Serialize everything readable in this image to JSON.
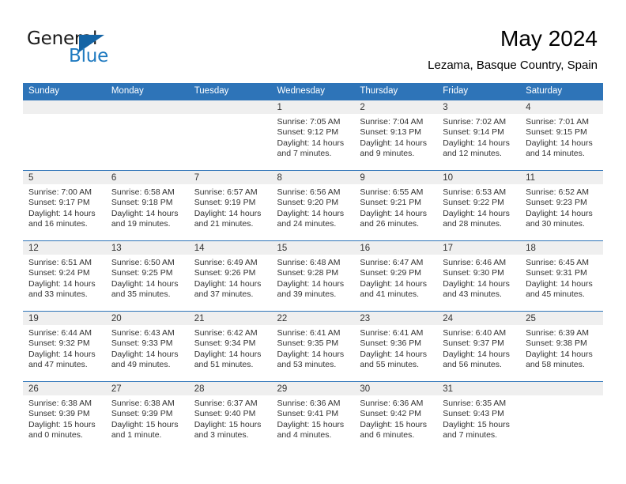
{
  "brand": {
    "name_part1": "General",
    "name_part2": "Blue",
    "logo_icon": "triangle-icon",
    "accent_color": "#1f7ac0",
    "header_color": "#2e74b8"
  },
  "header": {
    "title": "May 2024",
    "subtitle": "Lezama, Basque Country, Spain"
  },
  "calendar": {
    "weekday_headers": [
      "Sunday",
      "Monday",
      "Tuesday",
      "Wednesday",
      "Thursday",
      "Friday",
      "Saturday"
    ],
    "weeks": [
      [
        {
          "day": "",
          "sunrise": "",
          "sunset": "",
          "daylight1": "",
          "daylight2": ""
        },
        {
          "day": "",
          "sunrise": "",
          "sunset": "",
          "daylight1": "",
          "daylight2": ""
        },
        {
          "day": "",
          "sunrise": "",
          "sunset": "",
          "daylight1": "",
          "daylight2": ""
        },
        {
          "day": "1",
          "sunrise": "Sunrise: 7:05 AM",
          "sunset": "Sunset: 9:12 PM",
          "daylight1": "Daylight: 14 hours",
          "daylight2": "and 7 minutes."
        },
        {
          "day": "2",
          "sunrise": "Sunrise: 7:04 AM",
          "sunset": "Sunset: 9:13 PM",
          "daylight1": "Daylight: 14 hours",
          "daylight2": "and 9 minutes."
        },
        {
          "day": "3",
          "sunrise": "Sunrise: 7:02 AM",
          "sunset": "Sunset: 9:14 PM",
          "daylight1": "Daylight: 14 hours",
          "daylight2": "and 12 minutes."
        },
        {
          "day": "4",
          "sunrise": "Sunrise: 7:01 AM",
          "sunset": "Sunset: 9:15 PM",
          "daylight1": "Daylight: 14 hours",
          "daylight2": "and 14 minutes."
        }
      ],
      [
        {
          "day": "5",
          "sunrise": "Sunrise: 7:00 AM",
          "sunset": "Sunset: 9:17 PM",
          "daylight1": "Daylight: 14 hours",
          "daylight2": "and 16 minutes."
        },
        {
          "day": "6",
          "sunrise": "Sunrise: 6:58 AM",
          "sunset": "Sunset: 9:18 PM",
          "daylight1": "Daylight: 14 hours",
          "daylight2": "and 19 minutes."
        },
        {
          "day": "7",
          "sunrise": "Sunrise: 6:57 AM",
          "sunset": "Sunset: 9:19 PM",
          "daylight1": "Daylight: 14 hours",
          "daylight2": "and 21 minutes."
        },
        {
          "day": "8",
          "sunrise": "Sunrise: 6:56 AM",
          "sunset": "Sunset: 9:20 PM",
          "daylight1": "Daylight: 14 hours",
          "daylight2": "and 24 minutes."
        },
        {
          "day": "9",
          "sunrise": "Sunrise: 6:55 AM",
          "sunset": "Sunset: 9:21 PM",
          "daylight1": "Daylight: 14 hours",
          "daylight2": "and 26 minutes."
        },
        {
          "day": "10",
          "sunrise": "Sunrise: 6:53 AM",
          "sunset": "Sunset: 9:22 PM",
          "daylight1": "Daylight: 14 hours",
          "daylight2": "and 28 minutes."
        },
        {
          "day": "11",
          "sunrise": "Sunrise: 6:52 AM",
          "sunset": "Sunset: 9:23 PM",
          "daylight1": "Daylight: 14 hours",
          "daylight2": "and 30 minutes."
        }
      ],
      [
        {
          "day": "12",
          "sunrise": "Sunrise: 6:51 AM",
          "sunset": "Sunset: 9:24 PM",
          "daylight1": "Daylight: 14 hours",
          "daylight2": "and 33 minutes."
        },
        {
          "day": "13",
          "sunrise": "Sunrise: 6:50 AM",
          "sunset": "Sunset: 9:25 PM",
          "daylight1": "Daylight: 14 hours",
          "daylight2": "and 35 minutes."
        },
        {
          "day": "14",
          "sunrise": "Sunrise: 6:49 AM",
          "sunset": "Sunset: 9:26 PM",
          "daylight1": "Daylight: 14 hours",
          "daylight2": "and 37 minutes."
        },
        {
          "day": "15",
          "sunrise": "Sunrise: 6:48 AM",
          "sunset": "Sunset: 9:28 PM",
          "daylight1": "Daylight: 14 hours",
          "daylight2": "and 39 minutes."
        },
        {
          "day": "16",
          "sunrise": "Sunrise: 6:47 AM",
          "sunset": "Sunset: 9:29 PM",
          "daylight1": "Daylight: 14 hours",
          "daylight2": "and 41 minutes."
        },
        {
          "day": "17",
          "sunrise": "Sunrise: 6:46 AM",
          "sunset": "Sunset: 9:30 PM",
          "daylight1": "Daylight: 14 hours",
          "daylight2": "and 43 minutes."
        },
        {
          "day": "18",
          "sunrise": "Sunrise: 6:45 AM",
          "sunset": "Sunset: 9:31 PM",
          "daylight1": "Daylight: 14 hours",
          "daylight2": "and 45 minutes."
        }
      ],
      [
        {
          "day": "19",
          "sunrise": "Sunrise: 6:44 AM",
          "sunset": "Sunset: 9:32 PM",
          "daylight1": "Daylight: 14 hours",
          "daylight2": "and 47 minutes."
        },
        {
          "day": "20",
          "sunrise": "Sunrise: 6:43 AM",
          "sunset": "Sunset: 9:33 PM",
          "daylight1": "Daylight: 14 hours",
          "daylight2": "and 49 minutes."
        },
        {
          "day": "21",
          "sunrise": "Sunrise: 6:42 AM",
          "sunset": "Sunset: 9:34 PM",
          "daylight1": "Daylight: 14 hours",
          "daylight2": "and 51 minutes."
        },
        {
          "day": "22",
          "sunrise": "Sunrise: 6:41 AM",
          "sunset": "Sunset: 9:35 PM",
          "daylight1": "Daylight: 14 hours",
          "daylight2": "and 53 minutes."
        },
        {
          "day": "23",
          "sunrise": "Sunrise: 6:41 AM",
          "sunset": "Sunset: 9:36 PM",
          "daylight1": "Daylight: 14 hours",
          "daylight2": "and 55 minutes."
        },
        {
          "day": "24",
          "sunrise": "Sunrise: 6:40 AM",
          "sunset": "Sunset: 9:37 PM",
          "daylight1": "Daylight: 14 hours",
          "daylight2": "and 56 minutes."
        },
        {
          "day": "25",
          "sunrise": "Sunrise: 6:39 AM",
          "sunset": "Sunset: 9:38 PM",
          "daylight1": "Daylight: 14 hours",
          "daylight2": "and 58 minutes."
        }
      ],
      [
        {
          "day": "26",
          "sunrise": "Sunrise: 6:38 AM",
          "sunset": "Sunset: 9:39 PM",
          "daylight1": "Daylight: 15 hours",
          "daylight2": "and 0 minutes."
        },
        {
          "day": "27",
          "sunrise": "Sunrise: 6:38 AM",
          "sunset": "Sunset: 9:39 PM",
          "daylight1": "Daylight: 15 hours",
          "daylight2": "and 1 minute."
        },
        {
          "day": "28",
          "sunrise": "Sunrise: 6:37 AM",
          "sunset": "Sunset: 9:40 PM",
          "daylight1": "Daylight: 15 hours",
          "daylight2": "and 3 minutes."
        },
        {
          "day": "29",
          "sunrise": "Sunrise: 6:36 AM",
          "sunset": "Sunset: 9:41 PM",
          "daylight1": "Daylight: 15 hours",
          "daylight2": "and 4 minutes."
        },
        {
          "day": "30",
          "sunrise": "Sunrise: 6:36 AM",
          "sunset": "Sunset: 9:42 PM",
          "daylight1": "Daylight: 15 hours",
          "daylight2": "and 6 minutes."
        },
        {
          "day": "31",
          "sunrise": "Sunrise: 6:35 AM",
          "sunset": "Sunset: 9:43 PM",
          "daylight1": "Daylight: 15 hours",
          "daylight2": "and 7 minutes."
        },
        {
          "day": "",
          "sunrise": "",
          "sunset": "",
          "daylight1": "",
          "daylight2": ""
        }
      ]
    ]
  }
}
